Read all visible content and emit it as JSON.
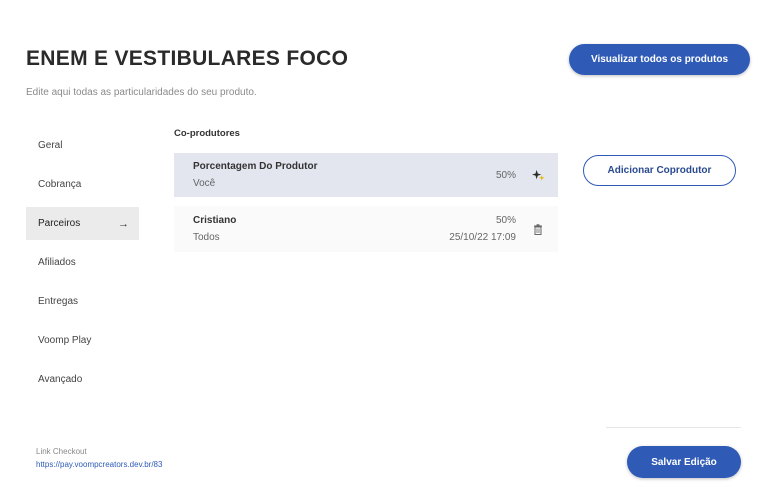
{
  "header": {
    "title": "ENEM E VESTIBULARES FOCO",
    "subtitle": "Edite aqui todas as particularidades do seu produto.",
    "view_all_label": "Visualizar todos os produtos"
  },
  "sidebar": {
    "items": [
      {
        "label": "Geral"
      },
      {
        "label": "Cobrança"
      },
      {
        "label": "Parceiros",
        "active": true
      },
      {
        "label": "Afiliados"
      },
      {
        "label": "Entregas"
      },
      {
        "label": "Voomp Play"
      },
      {
        "label": "Avançado"
      }
    ]
  },
  "main": {
    "section_label": "Co-produtores",
    "add_button_label": "Adicionar Coprodutor",
    "rows": [
      {
        "name": "Porcentagem Do Produtor",
        "sub": "Você",
        "percent": "50%",
        "date": "",
        "icon": "sparkle-icon"
      },
      {
        "name": "Cristiano",
        "sub": "Todos",
        "percent": "50%",
        "date": "25/10/22 17:09",
        "icon": "trash-icon"
      }
    ]
  },
  "footer": {
    "link_label": "Link Checkout",
    "link_url": "https://pay.voompcreators.dev.br/83",
    "save_label": "Salvar Edição"
  },
  "colors": {
    "accent": "#2f5bb7",
    "active_row": "#e3e6ef",
    "sidebar_active": "#ebebeb"
  }
}
